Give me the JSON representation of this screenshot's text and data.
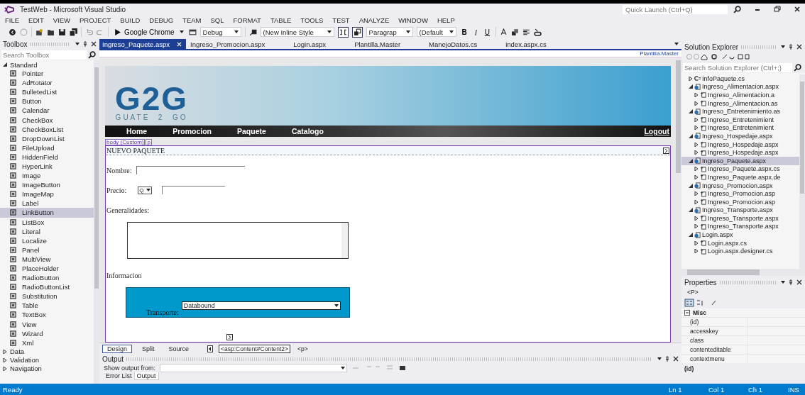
{
  "window": {
    "title": "TestWeb - Microsoft Visual Studio",
    "quick_launch": {
      "placeholder": "Quick Launch (Ctrl+Q)"
    }
  },
  "menu": [
    "FILE",
    "EDIT",
    "VIEW",
    "PROJECT",
    "BUILD",
    "DEBUG",
    "TEAM",
    "SQL",
    "FORMAT",
    "TABLE",
    "TOOLS",
    "TEST",
    "ANALYZE",
    "WINDOW",
    "HELP"
  ],
  "toolbar": {
    "run_target": "Google Chrome",
    "configuration": "Debug",
    "style": "(New Inline Style",
    "block_format": "Paragrap",
    "font": "(Default",
    "format_buttons": [
      {
        "label": "B",
        "kind": "bold"
      },
      {
        "label": "I",
        "kind": "italic"
      },
      {
        "label": "U",
        "kind": "underline"
      }
    ]
  },
  "toolbox": {
    "title": "Toolbox",
    "search": {
      "placeholder": "Search Toolbox"
    },
    "groups": [
      {
        "label": "Standard",
        "expanded": true,
        "items": [
          {
            "label": "Pointer",
            "selected": false
          },
          {
            "label": "AdRotator",
            "selected": false
          },
          {
            "label": "BulletedList",
            "selected": false
          },
          {
            "label": "Button",
            "selected": false
          },
          {
            "label": "Calendar",
            "selected": false
          },
          {
            "label": "CheckBox",
            "selected": false
          },
          {
            "label": "CheckBoxList",
            "selected": false
          },
          {
            "label": "DropDownList",
            "selected": false
          },
          {
            "label": "FileUpload",
            "selected": false
          },
          {
            "label": "HiddenField",
            "selected": false
          },
          {
            "label": "HyperLink",
            "selected": false
          },
          {
            "label": "Image",
            "selected": false
          },
          {
            "label": "ImageButton",
            "selected": false
          },
          {
            "label": "ImageMap",
            "selected": false
          },
          {
            "label": "Label",
            "selected": false
          },
          {
            "label": "LinkButton",
            "selected": true
          },
          {
            "label": "ListBox",
            "selected": false
          },
          {
            "label": "Literal",
            "selected": false
          },
          {
            "label": "Localize",
            "selected": false
          },
          {
            "label": "Panel",
            "selected": false
          },
          {
            "label": "MultiView",
            "selected": false
          },
          {
            "label": "PlaceHolder",
            "selected": false
          },
          {
            "label": "RadioButton",
            "selected": false
          },
          {
            "label": "RadioButtonList",
            "selected": false
          },
          {
            "label": "Substitution",
            "selected": false
          },
          {
            "label": "Table",
            "selected": false
          },
          {
            "label": "TextBox",
            "selected": false
          },
          {
            "label": "View",
            "selected": false
          },
          {
            "label": "Wizard",
            "selected": false
          },
          {
            "label": "Xml",
            "selected": false
          }
        ]
      },
      {
        "label": "Data",
        "expanded": false
      },
      {
        "label": "Validation",
        "expanded": false
      },
      {
        "label": "Navigation",
        "expanded": false
      }
    ]
  },
  "document_tabs": [
    {
      "label": "Ingreso_Paquete.aspx",
      "selected": true
    },
    {
      "label": "Ingreso_Promocion.aspx",
      "selected": false
    },
    {
      "label": "Login.aspx",
      "selected": false
    },
    {
      "label": "Plantilla.Master",
      "selected": false
    },
    {
      "label": "ManejoDatos.cs",
      "selected": false
    },
    {
      "label": "index.aspx.cs",
      "selected": false
    }
  ],
  "master_page": "Plantilla.Master",
  "designer": {
    "logo": "G2G",
    "tagline": "GUATE  2  GO",
    "nav": [
      {
        "label": "Home"
      },
      {
        "label": "Promocion"
      },
      {
        "label": "Paquete"
      },
      {
        "label": "Catalogo"
      }
    ],
    "logout": "Logout",
    "tags": [
      "body (Custom)",
      "p"
    ],
    "heading": "NUEVO PAQUETE",
    "name_label": "Nombre:",
    "price_label": "Precio:",
    "currency": "Q",
    "general_label": "Generalidades:",
    "info_label": "Informacion",
    "transport_label": "Transporte:",
    "transport_value": "Databound"
  },
  "view_tabs": [
    {
      "label": "Design",
      "selected": true
    },
    {
      "label": "Split",
      "selected": false
    },
    {
      "label": "Source",
      "selected": false
    }
  ],
  "breadcrumb": [
    "<asp:Content#Content2>",
    "<p>"
  ],
  "output": {
    "title": "Output",
    "source_label": "Show output from:",
    "tabs": [
      {
        "label": "Error List",
        "selected": false
      },
      {
        "label": "Output",
        "selected": true
      }
    ]
  },
  "solution_explorer": {
    "title": "Solution Explorer",
    "search": {
      "placeholder": "Search Solution Explorer (Ctrl+;)"
    },
    "tree": [
      {
        "label": "InfoPaquete.cs",
        "kind": "cs",
        "expanded": false,
        "selected": false
      },
      {
        "label": "Ingreso_Alimentacion.aspx",
        "kind": "page",
        "expanded": true,
        "selected": false,
        "children": [
          {
            "label": "Ingreso_Alimentacion.a",
            "kind": "code",
            "expanded": false,
            "selected": false
          },
          {
            "label": "Ingreso_Alimentacion.as",
            "kind": "code",
            "expanded": false,
            "selected": false
          }
        ]
      },
      {
        "label": "Ingreso_Entretenimiento.as",
        "kind": "page",
        "expanded": true,
        "selected": false,
        "children": [
          {
            "label": "Ingreso_Entretenimient",
            "kind": "code",
            "expanded": false,
            "selected": false
          },
          {
            "label": "Ingreso_Entretenimient",
            "kind": "code",
            "expanded": false,
            "selected": false
          }
        ]
      },
      {
        "label": "Ingreso_Hospedaje.aspx",
        "kind": "page",
        "expanded": true,
        "selected": false,
        "children": [
          {
            "label": "Ingreso_Hospedaje.aspx",
            "kind": "code",
            "expanded": false,
            "selected": false
          },
          {
            "label": "Ingreso_Hospedaje.aspx",
            "kind": "code",
            "expanded": false,
            "selected": false
          }
        ]
      },
      {
        "label": "Ingreso_Paquete.aspx",
        "kind": "page",
        "expanded": true,
        "selected": true,
        "children": [
          {
            "label": "Ingreso_Paquete.aspx.cs",
            "kind": "code",
            "expanded": false,
            "selected": false
          },
          {
            "label": "Ingreso_Paquete.aspx.de",
            "kind": "code",
            "expanded": false,
            "selected": false
          }
        ]
      },
      {
        "label": "Ingreso_Promocion.aspx",
        "kind": "page",
        "expanded": true,
        "selected": false,
        "children": [
          {
            "label": "Ingreso_Promocion.asp",
            "kind": "code",
            "expanded": false,
            "selected": false
          },
          {
            "label": "Ingreso_Promocion.asp",
            "kind": "code",
            "expanded": false,
            "selected": false
          }
        ]
      },
      {
        "label": "Ingreso_Transporte.aspx",
        "kind": "page",
        "expanded": true,
        "selected": false,
        "children": [
          {
            "label": "Ingreso_Transporte.aspx",
            "kind": "code",
            "expanded": false,
            "selected": false
          },
          {
            "label": "Ingreso_Transporte.aspx",
            "kind": "code",
            "expanded": false,
            "selected": false
          }
        ]
      },
      {
        "label": "Login.aspx",
        "kind": "page",
        "expanded": true,
        "selected": false,
        "children": [
          {
            "label": "Login.aspx.cs",
            "kind": "code",
            "expanded": false,
            "selected": false
          },
          {
            "label": "Login.aspx.designer.cs",
            "kind": "code",
            "expanded": false,
            "selected": false
          }
        ]
      }
    ]
  },
  "properties": {
    "title": "Properties",
    "object": "<P>",
    "category": "Misc",
    "rows": [
      "(id)",
      "accesskey",
      "class",
      "contenteditable",
      "contextmenu"
    ],
    "description": "(id)"
  },
  "status_bar": {
    "text": "Ready",
    "line": "Ln 1",
    "column": "Col 1",
    "char": "Ch 1",
    "mode": "INS"
  }
}
